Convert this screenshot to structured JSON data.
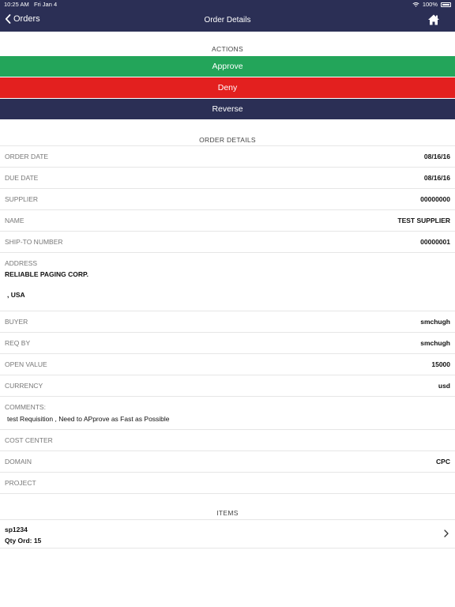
{
  "status_bar": {
    "time": "10:25 AM",
    "date": "Fri Jan 4",
    "battery": "100%"
  },
  "nav": {
    "back_label": "Orders",
    "title": "Order Details"
  },
  "actions": {
    "header": "ACTIONS",
    "approve": "Approve",
    "deny": "Deny",
    "reverse": "Reverse",
    "colors": {
      "approve": "#23a55a",
      "deny": "#e3201f",
      "reverse": "#2b2f55"
    }
  },
  "details": {
    "header": "ORDER DETAILS",
    "rows": [
      {
        "label": "ORDER DATE",
        "value": "08/16/16"
      },
      {
        "label": "DUE DATE",
        "value": "08/16/16"
      },
      {
        "label": "SUPPLIER",
        "value": "00000000"
      },
      {
        "label": "NAME",
        "value": "TEST SUPPLIER"
      },
      {
        "label": "SHIP-TO NUMBER",
        "value": "00000001"
      }
    ],
    "address": {
      "label": "ADDRESS",
      "line1": "RELIABLE PAGING CORP.",
      "line2": ",  USA"
    },
    "rows2": [
      {
        "label": "BUYER",
        "value": "smchugh"
      },
      {
        "label": "REQ BY",
        "value": "smchugh"
      },
      {
        "label": "OPEN VALUE",
        "value": "15000"
      },
      {
        "label": "CURRENCY",
        "value": "usd"
      }
    ],
    "comments": {
      "label": "COMMENTS:",
      "text": "test Requisition , Need to APprove as Fast as Possible"
    },
    "rows3": [
      {
        "label": "COST CENTER",
        "value": ""
      },
      {
        "label": "DOMAIN",
        "value": "CPC"
      },
      {
        "label": "PROJECT",
        "value": ""
      }
    ]
  },
  "items": {
    "header": "ITEMS",
    "list": [
      {
        "name": "sp1234",
        "qty": "Qty Ord:  15"
      }
    ]
  },
  "icons": {
    "back": "chevron-left-icon",
    "home": "home-icon",
    "row_chevron": "chevron-right-icon",
    "wifi": "wifi-icon",
    "battery": "battery-icon"
  },
  "theme": {
    "nav_bg": "#2b2f55"
  }
}
